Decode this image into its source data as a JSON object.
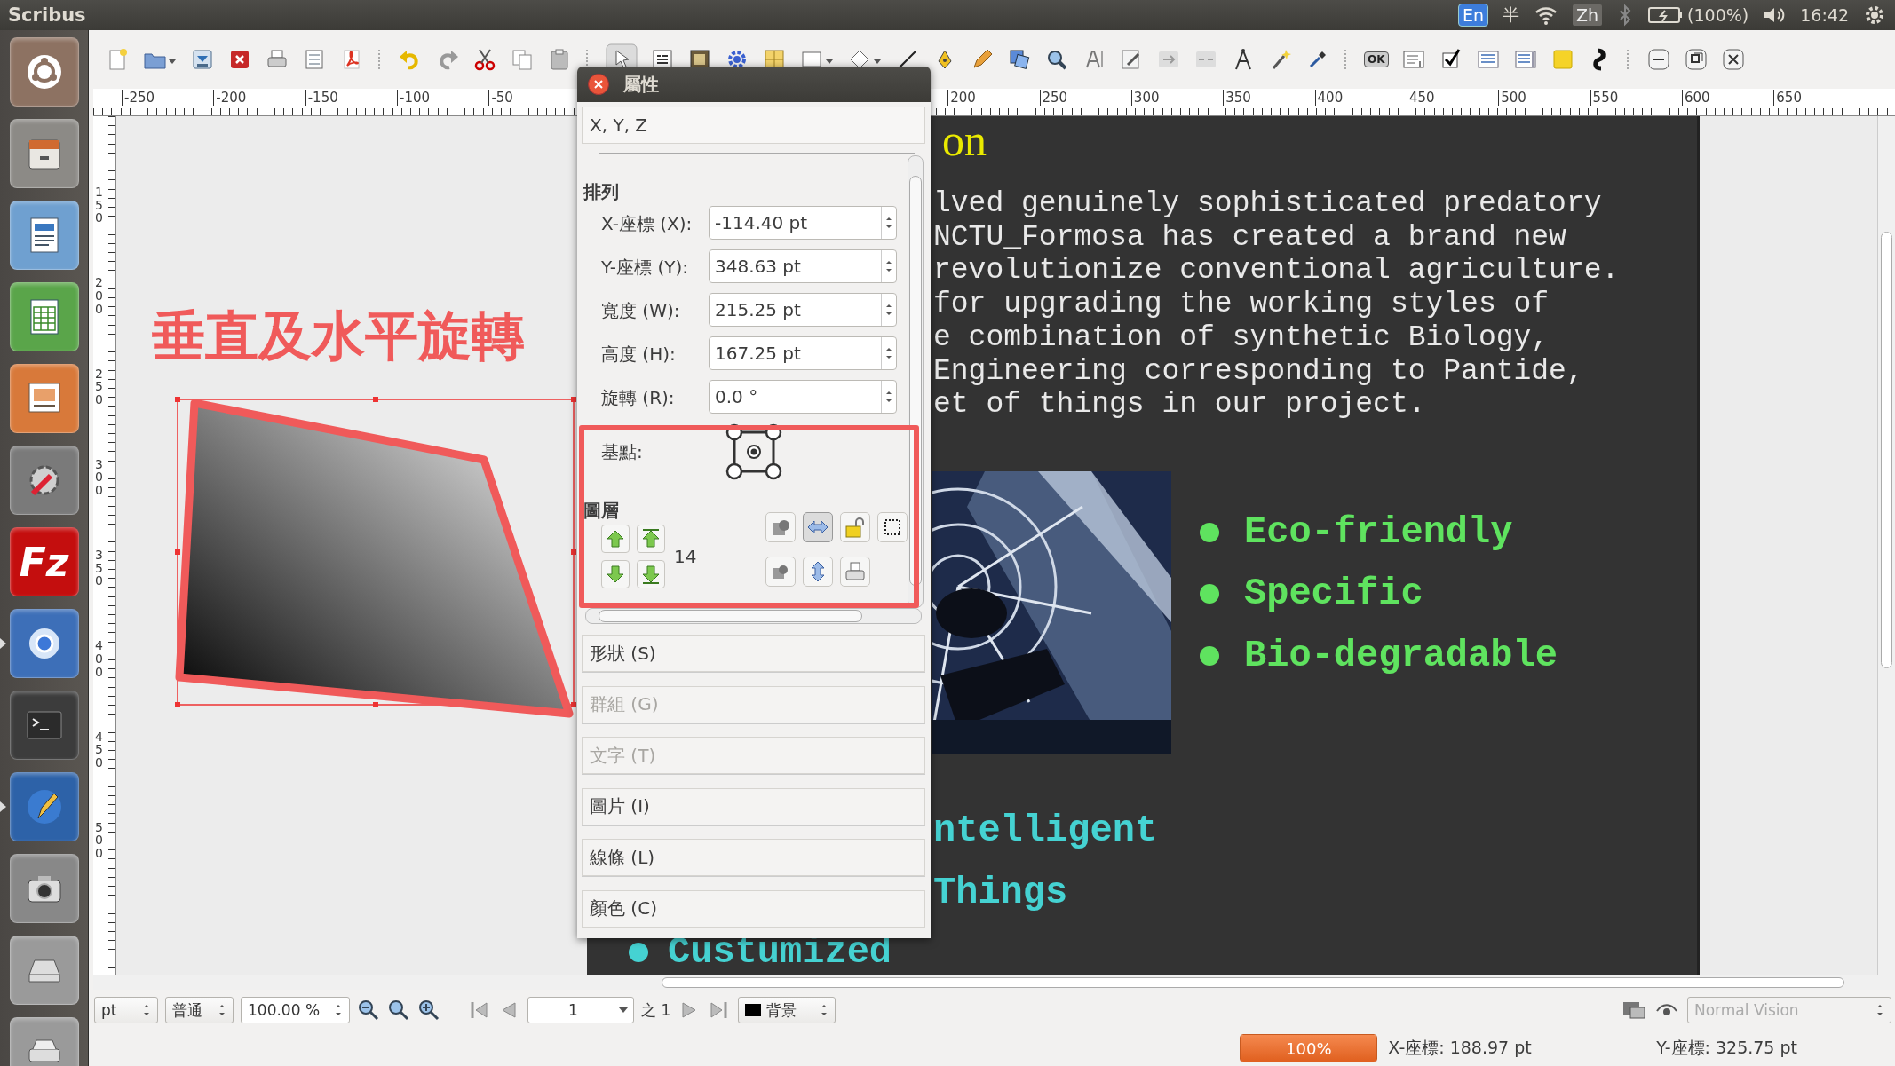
{
  "top_bar": {
    "app_name": "Scribus",
    "input_method": "En",
    "char_width": "半",
    "language": "Zh",
    "battery": "(100%)",
    "time": "16:42"
  },
  "launcher": [
    {
      "kind": "ubuntu",
      "running": false
    },
    {
      "kind": "files",
      "running": false
    },
    {
      "kind": "writer",
      "running": false
    },
    {
      "kind": "calc",
      "running": false
    },
    {
      "kind": "impress",
      "running": false
    },
    {
      "kind": "settings",
      "running": false
    },
    {
      "kind": "filezilla",
      "label": "Fz",
      "running": false
    },
    {
      "kind": "chromium",
      "running": true
    },
    {
      "kind": "terminal",
      "running": false
    },
    {
      "kind": "scribus",
      "running": true
    },
    {
      "kind": "camera",
      "running": false
    },
    {
      "kind": "drive",
      "running": false
    },
    {
      "kind": "scanner",
      "running": false
    }
  ],
  "toolbar": {
    "form_button_label": "OK"
  },
  "rulers": {
    "horizontal": [
      "-250",
      "-200",
      "-150",
      "-100",
      "-50",
      "200",
      "250",
      "300",
      "350",
      "400",
      "450",
      "500",
      "550",
      "600",
      "650"
    ],
    "vertical": [
      "150",
      "200",
      "250",
      "300",
      "350",
      "400",
      "450",
      "500"
    ]
  },
  "canvas": {
    "annotation_title": "垂直及水平旋轉"
  },
  "page": {
    "heading": "on",
    "paragraph": [
      "lved genuinely sophisticated predatory",
      "NCTU_Formosa has created a brand new",
      "revolutionize conventional agriculture.",
      "for upgrading the working styles of",
      "e combination of synthetic Biology,",
      "Engineering corresponding to Pantide,",
      "et of things in our project."
    ],
    "features": [
      "Eco-friendly",
      "Specific",
      "Bio-degradable"
    ],
    "applications": [
      {
        "text": "ntelligent",
        "bullet": false
      },
      {
        "text": "Things",
        "bullet": false
      },
      {
        "text": "Custumized",
        "bullet": true
      }
    ]
  },
  "properties": {
    "title": "屬性",
    "header": "X, Y, Z",
    "group": "排列",
    "fields": [
      {
        "label": "X-座標 (X):",
        "value": "-114.40 pt"
      },
      {
        "label": "Y-座標 (Y):",
        "value": "348.63 pt"
      },
      {
        "label": "寬度 (W):",
        "value": "215.25 pt"
      },
      {
        "label": "高度 (H):",
        "value": "167.25 pt"
      },
      {
        "label": "旋轉 (R):",
        "value": "0.0 °"
      }
    ],
    "base_point_label": "基點:",
    "layer_label": "圖層",
    "layer_level": "14",
    "sections": [
      {
        "label": "形狀 (S)",
        "disabled": false
      },
      {
        "label": "群組 (G)",
        "disabled": true
      },
      {
        "label": "文字 (T)",
        "disabled": true
      },
      {
        "label": "圖片 (I)",
        "disabled": false
      },
      {
        "label": "線條 (L)",
        "disabled": false
      },
      {
        "label": "顏色 (C)",
        "disabled": false
      }
    ]
  },
  "bottom_toolbar": {
    "unit": "pt",
    "mode": "普通",
    "zoom": "100.00 %",
    "page": "1",
    "page_total": "之 1",
    "layer": "背景",
    "vision": {
      "label": "Normal Vision",
      "disabled": true
    }
  },
  "status_bar": {
    "progress": "100%",
    "level": 1,
    "x_coord": "X-座標: 188.97 pt",
    "y_coord": "Y-座標: 325.75 pt"
  }
}
